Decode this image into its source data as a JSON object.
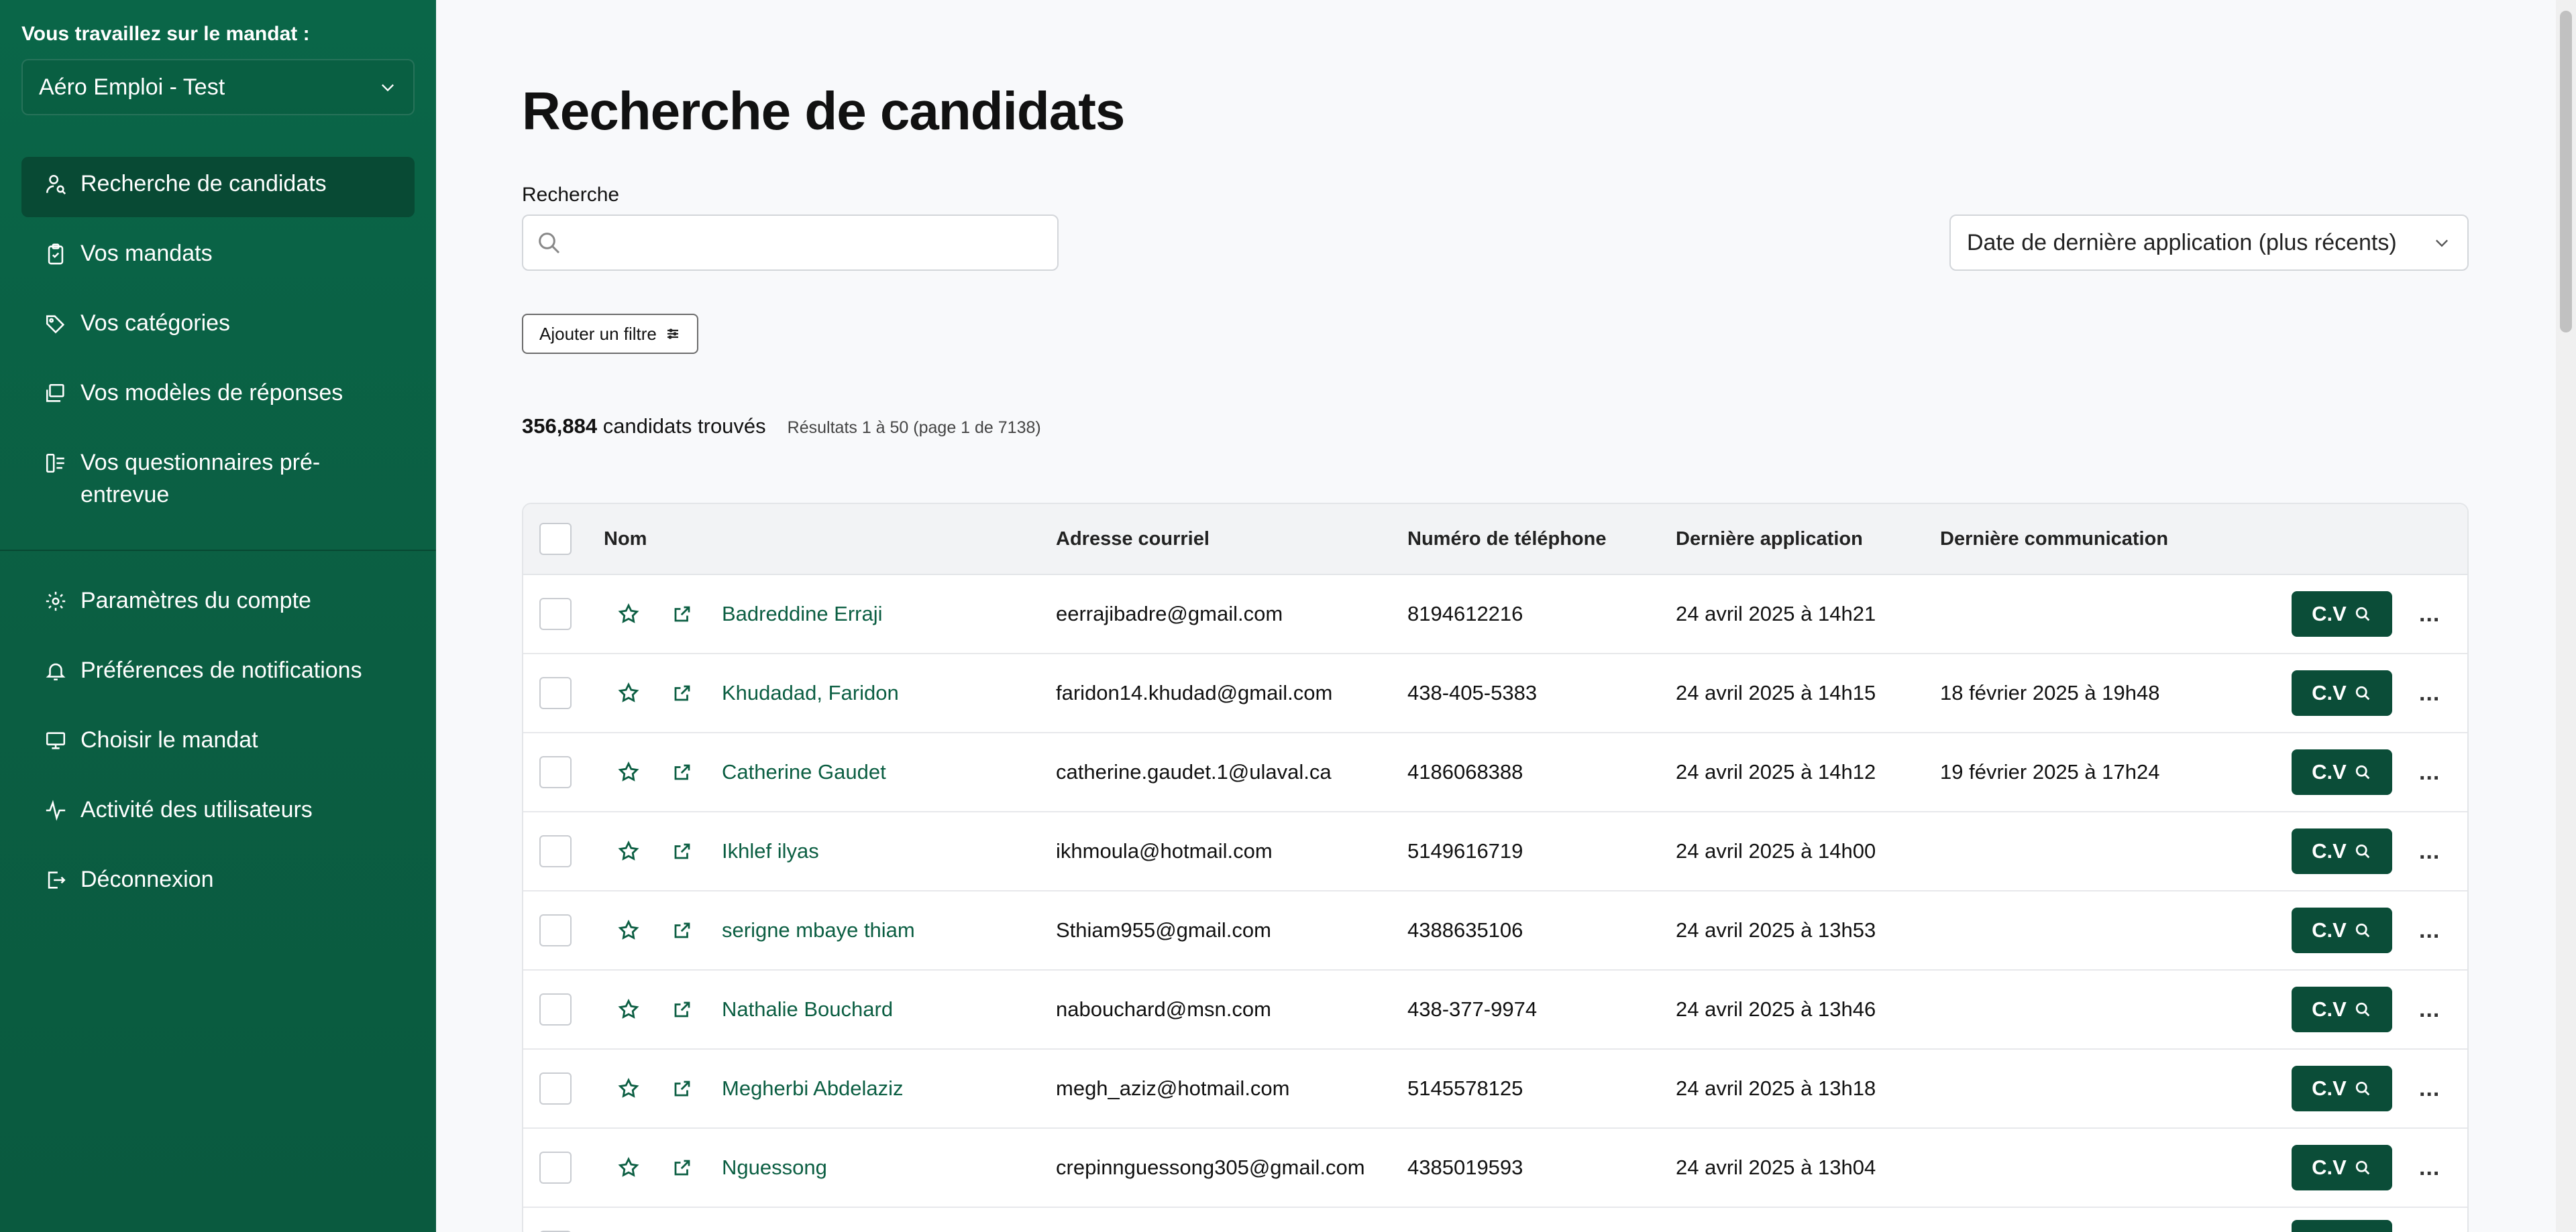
{
  "sidebar": {
    "mandate_caption": "Vous travaillez sur le mandat :",
    "mandate_value": "Aéro Emploi - Test",
    "nav_top": [
      {
        "label": "Recherche de candidats",
        "icon": "user-search-icon",
        "active": true
      },
      {
        "label": "Vos mandats",
        "icon": "clipboard-icon"
      },
      {
        "label": "Vos catégories",
        "icon": "tags-icon"
      },
      {
        "label": "Vos modèles de réponses",
        "icon": "template-icon"
      },
      {
        "label": "Vos questionnaires pré-entrevue",
        "icon": "questionnaire-icon"
      }
    ],
    "nav_bottom": [
      {
        "label": "Paramètres du compte",
        "icon": "gear-icon"
      },
      {
        "label": "Préférences de notifications",
        "icon": "bell-icon"
      },
      {
        "label": "Choisir le mandat",
        "icon": "monitor-icon"
      },
      {
        "label": "Activité des utilisateurs",
        "icon": "activity-icon"
      },
      {
        "label": "Déconnexion",
        "icon": "logout-icon"
      }
    ]
  },
  "main": {
    "title": "Recherche de candidats",
    "search_label": "Recherche",
    "search_value": "",
    "sort_value": "Date de dernière application (plus récents)",
    "filter_button": "Ajouter un filtre",
    "result_count": "356,884",
    "result_count_suffix": "candidats trouvés",
    "result_range": "Résultats 1 à 50 (page 1 de 7138)"
  },
  "table": {
    "headers": {
      "name": "Nom",
      "email": "Adresse courriel",
      "phone": "Numéro de téléphone",
      "last_application": "Dernière application",
      "last_communication": "Dernière communication"
    },
    "cv_label": "C.V",
    "more_label": "...",
    "rows": [
      {
        "name": "Badreddine Erraji",
        "email": "eerrajibadre@gmail.com",
        "phone": "8194612216",
        "last_application": "24 avril 2025 à 14h21",
        "last_communication": ""
      },
      {
        "name": "Khudadad, Faridon",
        "email": "faridon14.khudad@gmail.com",
        "phone": "438-405-5383",
        "last_application": "24 avril 2025 à 14h15",
        "last_communication": "18 février 2025 à 19h48"
      },
      {
        "name": "Catherine Gaudet",
        "email": "catherine.gaudet.1@ulaval.ca",
        "phone": "4186068388",
        "last_application": "24 avril 2025 à 14h12",
        "last_communication": "19 février 2025 à 17h24"
      },
      {
        "name": "Ikhlef ilyas",
        "email": "ikhmoula@hotmail.com",
        "phone": "5149616719",
        "last_application": "24 avril 2025 à 14h00",
        "last_communication": ""
      },
      {
        "name": "serigne mbaye thiam",
        "email": "Sthiam955@gmail.com",
        "phone": "4388635106",
        "last_application": "24 avril 2025 à 13h53",
        "last_communication": ""
      },
      {
        "name": "Nathalie Bouchard",
        "email": "nabouchard@msn.com",
        "phone": "438-377-9974",
        "last_application": "24 avril 2025 à 13h46",
        "last_communication": ""
      },
      {
        "name": "Megherbi Abdelaziz",
        "email": "megh_aziz@hotmail.com",
        "phone": "5145578125",
        "last_application": "24 avril 2025 à 13h18",
        "last_communication": ""
      },
      {
        "name": "Nguessong",
        "email": "crepinnguessong305@gmail.com",
        "phone": "4385019593",
        "last_application": "24 avril 2025 à 13h04",
        "last_communication": ""
      },
      {
        "name": "",
        "email": "",
        "phone": "",
        "last_application": "",
        "last_communication": ""
      }
    ]
  },
  "colors": {
    "brand": "#0b5e42",
    "cv_button": "#0b4d38"
  }
}
